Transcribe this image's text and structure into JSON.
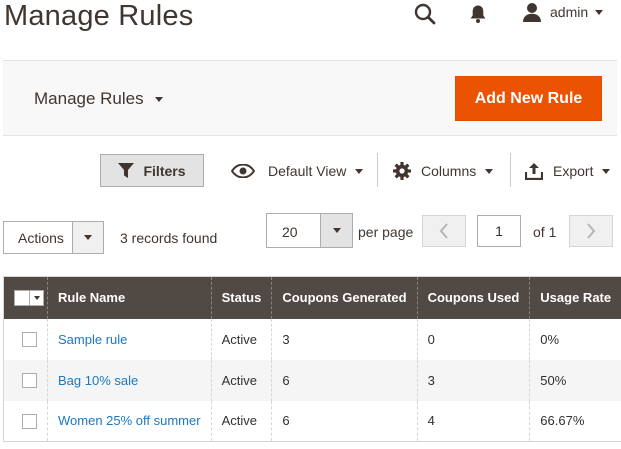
{
  "header": {
    "title": "Manage Rules",
    "user_name": "admin"
  },
  "page_actions": {
    "switcher_label": "Manage Rules",
    "add_button_label": "Add New Rule"
  },
  "toolbar": {
    "filters_label": "Filters",
    "view_label": "Default View",
    "columns_label": "Columns",
    "export_label": "Export"
  },
  "pager": {
    "actions_label": "Actions",
    "records_found": "3 records found",
    "per_page_value": "20",
    "per_page_label": "per page",
    "current_page": "1",
    "of_pages": "of 1"
  },
  "grid": {
    "columns": [
      "Rule Name",
      "Status",
      "Coupons Generated",
      "Coupons Used",
      "Usage Rate"
    ],
    "rows": [
      {
        "rule_name": "Sample rule",
        "status": "Active",
        "coupons_generated": "3",
        "coupons_used": "0",
        "usage_rate": "0%"
      },
      {
        "rule_name": "Bag 10% sale",
        "status": "Active",
        "coupons_generated": "6",
        "coupons_used": "3",
        "usage_rate": "50%"
      },
      {
        "rule_name": "Women 25% off summer",
        "status": "Active",
        "coupons_generated": "6",
        "coupons_used": "4",
        "usage_rate": "66.67%"
      }
    ]
  },
  "colors": {
    "accent": "#eb5202",
    "header_bg": "#514943",
    "link": "#1979c3"
  },
  "icons": {
    "search": "search-icon",
    "notifications": "bell-icon",
    "user": "user-icon",
    "filters": "filter-icon",
    "view": "eye-icon",
    "columns": "gear-icon",
    "export": "export-icon"
  }
}
